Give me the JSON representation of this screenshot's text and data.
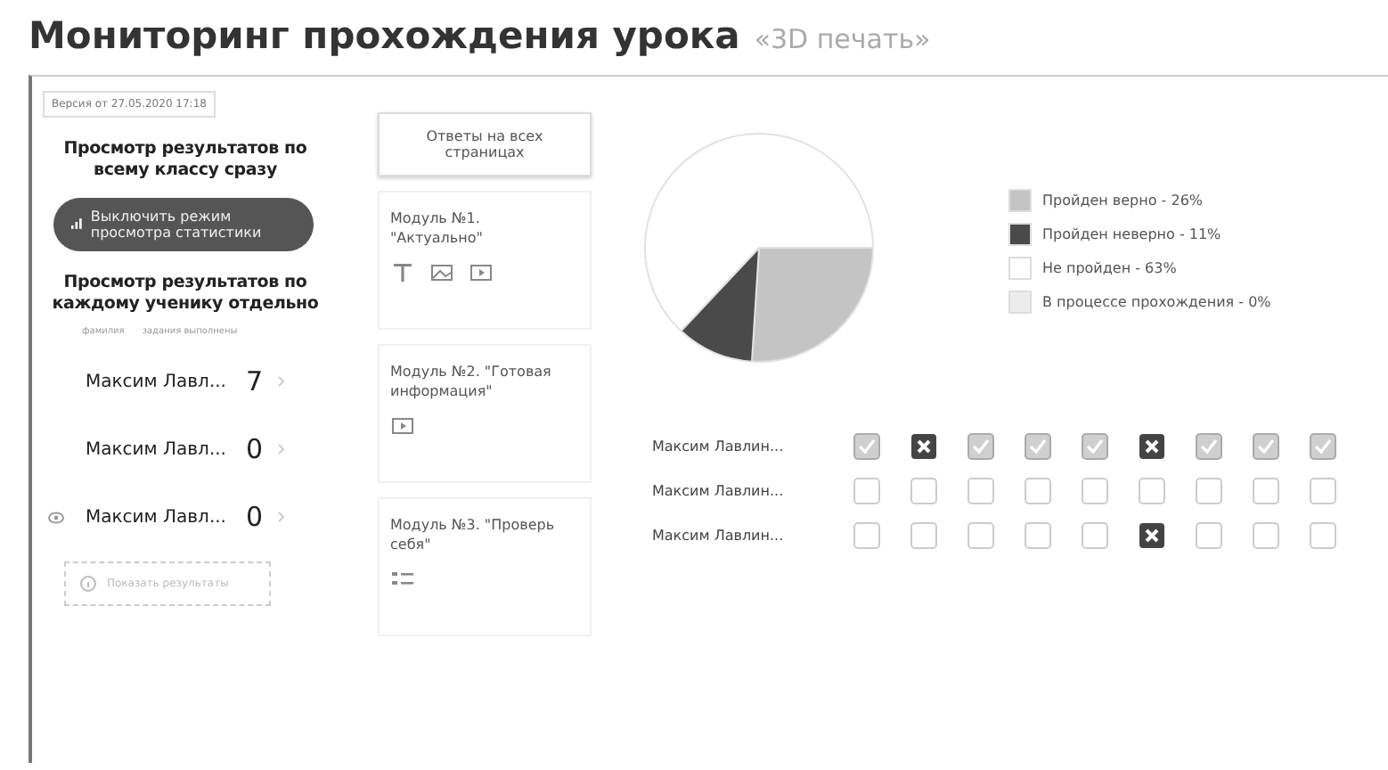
{
  "header": {
    "title": "Мониторинг прохождения урока",
    "lesson_name": "«3D печать»",
    "version": "Версия от 27.05.2020 17:18"
  },
  "class_view": {
    "heading": "Просмотр результатов по всему классу сразу",
    "toggle_button": "Выключить режим просмотра статистики"
  },
  "student_view": {
    "heading": "Просмотр результатов по каждому ученику отдельно",
    "columns": [
      "фамилия",
      "задания выполнены"
    ],
    "students": [
      {
        "name": "Максим Лавл...",
        "score": "7",
        "flagged": false
      },
      {
        "name": "Максим Лавл...",
        "score": "0",
        "flagged": false
      },
      {
        "name": "Максим Лавл...",
        "score": "0",
        "flagged": true
      }
    ],
    "show_button": "Показать результаты"
  },
  "modules_panel": {
    "all_pages_button": "Ответы на всех страницах",
    "modules": [
      {
        "title": "Модуль №1. \"Актуально\"",
        "icons": [
          {
            "kind": "text"
          },
          {
            "kind": "image"
          },
          {
            "kind": "video"
          }
        ]
      },
      {
        "title": "Модуль №2. \"Готовая информация\"",
        "icons": [
          {
            "kind": "video"
          }
        ]
      },
      {
        "title": "Модуль №3. \"Проверь себя\"",
        "icons": [
          {
            "kind": "list"
          }
        ]
      }
    ]
  },
  "summary": {
    "chart_data": {
      "type": "pie",
      "values": [
        26,
        11,
        63,
        0
      ]
    },
    "legend": [
      {
        "label": "Пройден верно - 26%",
        "kind": "correct"
      },
      {
        "label": "Пройден неверно - 11%",
        "kind": "wrong"
      },
      {
        "label": "Не пройден - 63%",
        "kind": "empty"
      },
      {
        "label": "В процессе прохождения - 0%",
        "kind": "progress"
      }
    ]
  },
  "results": [
    {
      "name": "Максим Лавлин...",
      "cells": [
        {
          "kind": "correct"
        },
        {
          "kind": "wrong"
        },
        {
          "kind": "correct"
        },
        {
          "kind": "correct"
        },
        {
          "kind": "correct"
        },
        {
          "kind": "wrong"
        },
        {
          "kind": "correct"
        },
        {
          "kind": "correct"
        },
        {
          "kind": "correct"
        }
      ]
    },
    {
      "name": "Максим Лавлин...",
      "cells": [
        {
          "kind": "empty"
        },
        {
          "kind": "empty"
        },
        {
          "kind": "empty"
        },
        {
          "kind": "empty"
        },
        {
          "kind": "empty"
        },
        {
          "kind": "empty"
        },
        {
          "kind": "empty"
        },
        {
          "kind": "empty"
        },
        {
          "kind": "empty"
        }
      ]
    },
    {
      "name": "Максим Лавлин...",
      "cells": [
        {
          "kind": "empty"
        },
        {
          "kind": "empty"
        },
        {
          "kind": "empty"
        },
        {
          "kind": "empty"
        },
        {
          "kind": "empty"
        },
        {
          "kind": "wrong"
        },
        {
          "kind": "empty"
        },
        {
          "kind": "empty"
        },
        {
          "kind": "empty"
        }
      ]
    }
  ]
}
